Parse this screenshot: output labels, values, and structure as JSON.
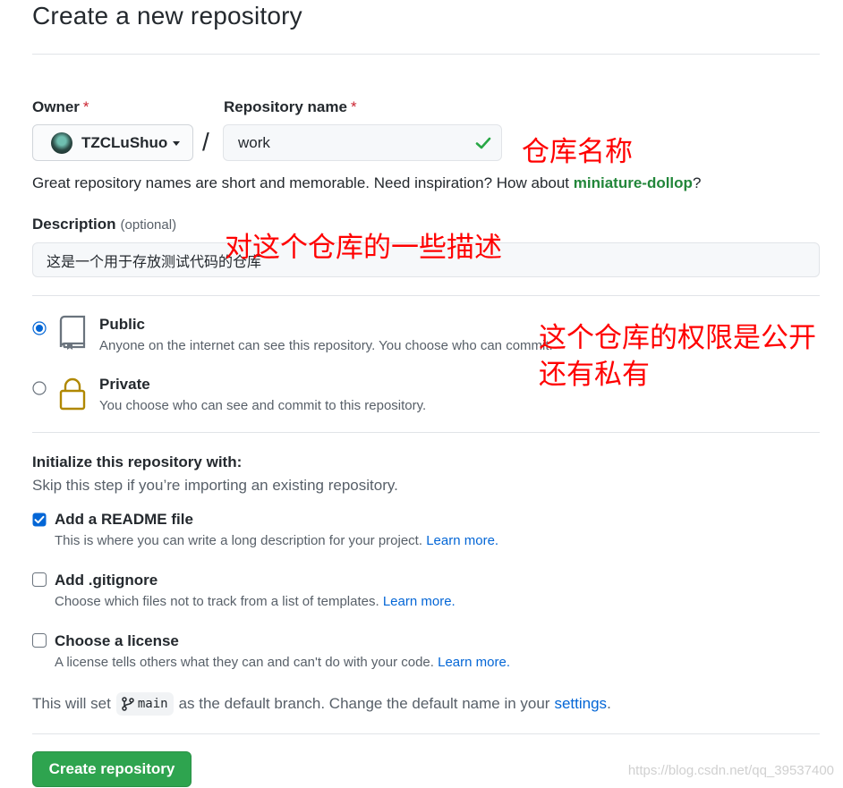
{
  "page": {
    "title": "Create a new repository"
  },
  "owner": {
    "label": "Owner",
    "required_mark": "*",
    "value": "TZCLuShuo"
  },
  "separator": "/",
  "repo_name": {
    "label": "Repository name",
    "required_mark": "*",
    "value": "work",
    "valid": true
  },
  "hint": {
    "text": "Great repository names are short and memorable. Need inspiration? How about ",
    "suggestion": "miniature-dollop",
    "end": "?"
  },
  "description": {
    "label": "Description",
    "optional": "(optional)",
    "value": "这是一个用于存放测试代码的仓库"
  },
  "visibility": {
    "options": [
      {
        "title": "Public",
        "desc": "Anyone on the internet can see this repository. You choose who can commit.",
        "selected": true,
        "icon": "repo-icon"
      },
      {
        "title": "Private",
        "desc": "You choose who can see and commit to this repository.",
        "selected": false,
        "icon": "lock-icon"
      }
    ]
  },
  "init": {
    "title": "Initialize this repository with:",
    "subtitle": "Skip this step if you’re importing an existing repository.",
    "options": [
      {
        "title": "Add a README file",
        "desc": "This is where you can write a long description for your project. ",
        "link": "Learn more.",
        "checked": true
      },
      {
        "title": "Add .gitignore",
        "desc": "Choose which files not to track from a list of templates. ",
        "link": "Learn more.",
        "checked": false
      },
      {
        "title": "Choose a license",
        "desc": "A license tells others what they can and can't do with your code. ",
        "link": "Learn more.",
        "checked": false
      }
    ]
  },
  "branch": {
    "prefix": "This will set",
    "name": "main",
    "suffix": "as the default branch. Change the default name in your",
    "link": "settings",
    "end": "."
  },
  "submit": {
    "label": "Create repository"
  },
  "annotations": {
    "repo_name_note": "仓库名称",
    "description_note": "对这个仓库的一些描述",
    "visibility_note_line1": "这个仓库的权限是公开",
    "visibility_note_line2": "还有私有"
  },
  "watermark": "https://blog.csdn.net/qq_39537400",
  "colors": {
    "accent": "#0366d6",
    "success": "#2ea44f",
    "suggestion": "#22863a",
    "annotation": "#ff0000",
    "lock": "#b08800"
  }
}
